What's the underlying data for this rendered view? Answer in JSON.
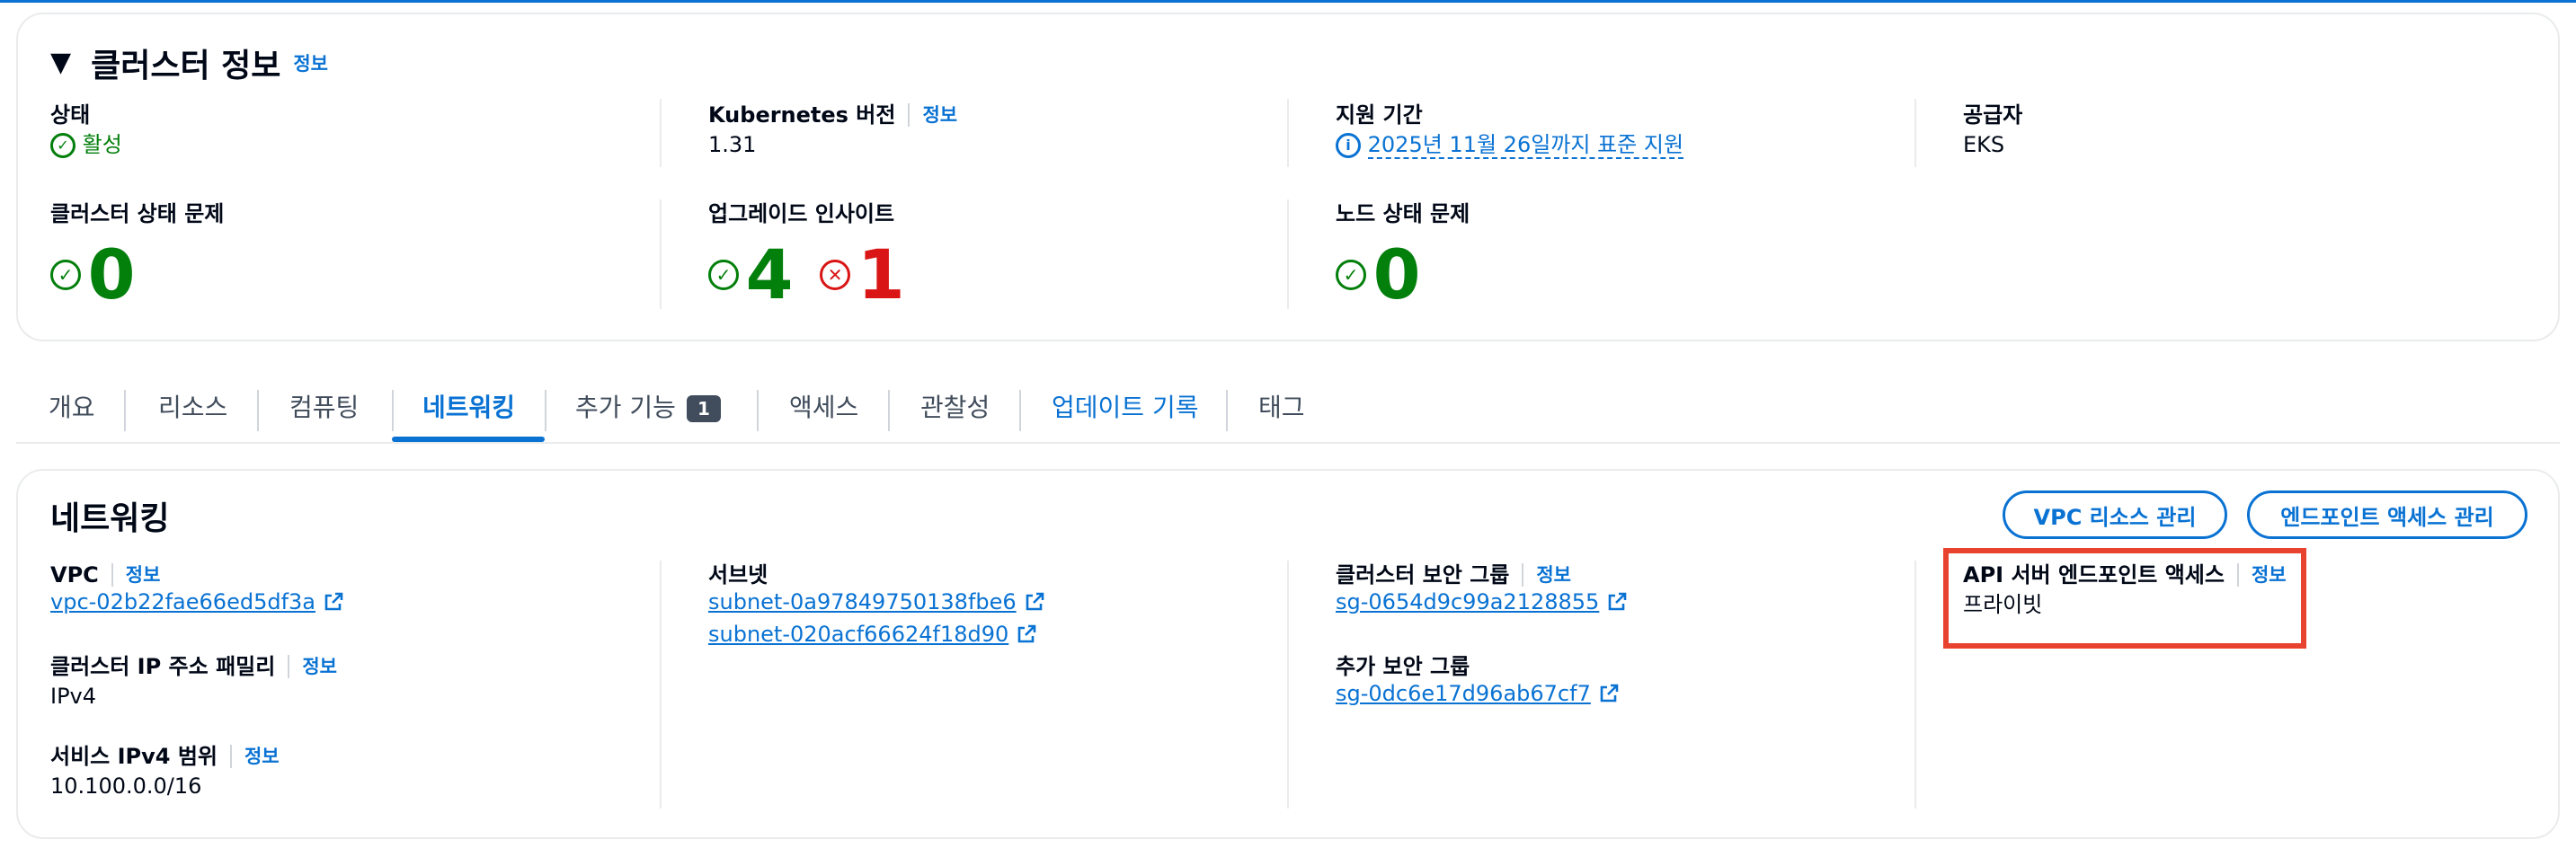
{
  "cluster_info": {
    "title": "클러스터 정보",
    "info": "정보",
    "status": {
      "label": "상태",
      "value": "활성"
    },
    "k8s_version": {
      "label": "Kubernetes 버전",
      "info": "정보",
      "value": "1.31"
    },
    "support_period": {
      "label": "지원 기간",
      "value": "2025년 11월 26일까지 표준 지원"
    },
    "provider": {
      "label": "공급자",
      "value": "EKS"
    },
    "health_issues": {
      "label": "클러스터 상태 문제",
      "value": "0"
    },
    "upgrade_insights": {
      "label": "업그레이드 인사이트",
      "passing": "4",
      "error": "1"
    },
    "node_health": {
      "label": "노드 상태 문제",
      "value": "0"
    }
  },
  "tabs": [
    {
      "label": "개요"
    },
    {
      "label": "리소스"
    },
    {
      "label": "컴퓨팅"
    },
    {
      "label": "네트워킹"
    },
    {
      "label": "추가 기능",
      "badge": "1"
    },
    {
      "label": "액세스"
    },
    {
      "label": "관찰성"
    },
    {
      "label": "업데이트 기록"
    },
    {
      "label": "태그"
    }
  ],
  "networking": {
    "title": "네트워킹",
    "buttons": {
      "vpc": "VPC 리소스 관리",
      "endpoint": "엔드포인트 액세스 관리"
    },
    "vpc": {
      "label": "VPC",
      "info": "정보",
      "value": "vpc-02b22fae66ed5df3a"
    },
    "ip_family": {
      "label": "클러스터 IP 주소 패밀리",
      "info": "정보",
      "value": "IPv4"
    },
    "service_range": {
      "label": "서비스 IPv4 범위",
      "info": "정보",
      "value": "10.100.0.0/16"
    },
    "subnets": {
      "label": "서브넷",
      "items": [
        "subnet-0a97849750138fbe6",
        "subnet-020acf66624f18d90"
      ]
    },
    "cluster_sg": {
      "label": "클러스터 보안 그룹",
      "info": "정보",
      "value": "sg-0654d9c99a2128855"
    },
    "additional_sg": {
      "label": "추가 보안 그룹",
      "value": "sg-0dc6e17d96ab67cf7"
    },
    "api_endpoint": {
      "label": "API 서버 엔드포인트 액세스",
      "info": "정보",
      "value": "프라이빗"
    }
  },
  "colors": {
    "accent": "#0972d3",
    "success": "#037f0c",
    "error": "#d91515",
    "highlight": "#e8432e"
  }
}
